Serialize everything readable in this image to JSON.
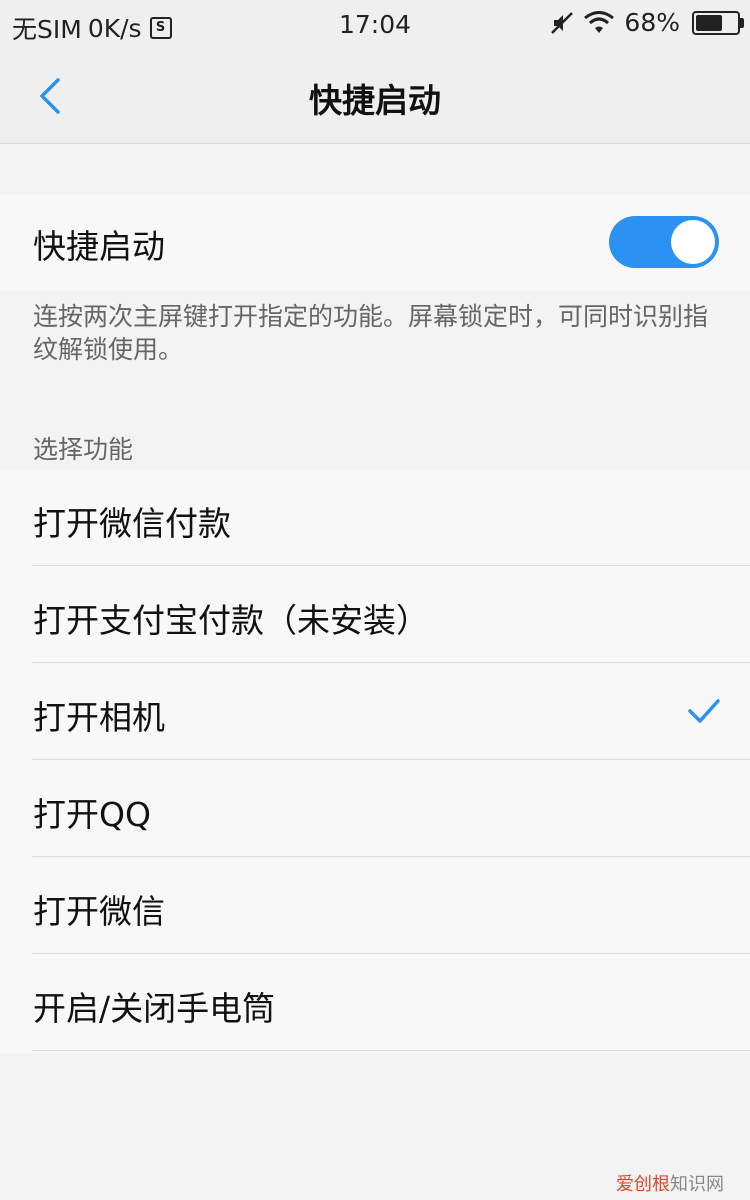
{
  "status_bar": {
    "carrier": "无SIM",
    "speed": "0K/s",
    "sim_icon_text": "S",
    "time": "17:04",
    "battery_percent": "68%",
    "battery_level": 0.68,
    "icons": [
      "sim-icon",
      "mute-icon",
      "wifi-icon",
      "battery-icon"
    ]
  },
  "nav": {
    "back_icon": "chevron-left-icon",
    "title": "快捷启动"
  },
  "toggle": {
    "label": "快捷启动",
    "state": "on"
  },
  "description": "连按两次主屏键打开指定的功能。屏幕锁定时，可同时识别指纹解锁使用。",
  "section_header": "选择功能",
  "options": [
    {
      "label": "打开微信付款",
      "selected": false
    },
    {
      "label": "打开支付宝付款（未安装）",
      "selected": false
    },
    {
      "label": "打开相机",
      "selected": true
    },
    {
      "label": "打开QQ",
      "selected": false
    },
    {
      "label": "打开微信",
      "selected": false
    },
    {
      "label": "开启/关闭手电筒",
      "selected": false
    }
  ],
  "watermark": {
    "accent": "爱创根",
    "rest": "知识网"
  },
  "colors": {
    "accent": "#2b91f2",
    "check": "#2b91f2",
    "background": "#f3f3f3"
  }
}
